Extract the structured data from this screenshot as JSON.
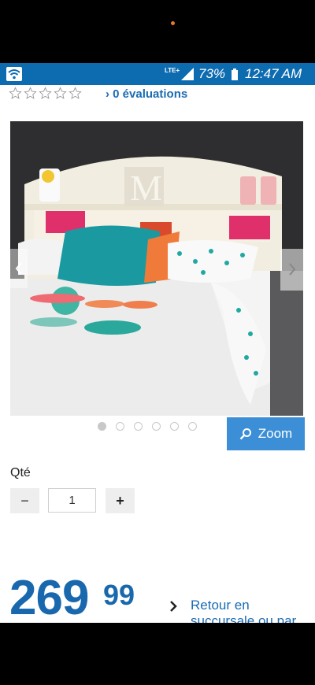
{
  "status_bar": {
    "network": "LTE+",
    "battery": "73%",
    "time": "12:47 AM",
    "colors": {
      "bar": "#0d6bb0",
      "notification_dot": "#e8792b"
    }
  },
  "product": {
    "rating_stars": 0,
    "rating_max": 5,
    "reviews_label": "0 évaluations",
    "image_count": 6,
    "active_image_index": 0,
    "zoom_label": "Zoom"
  },
  "quantity": {
    "label": "Qté",
    "minus": "−",
    "value": "1",
    "plus": "+"
  },
  "price": {
    "dollars": "269",
    "cents": "99",
    "color": "#1968ae"
  },
  "return": {
    "label": "Retour en succursale ou par"
  },
  "icons": [
    "wifi-icon",
    "signal-icon",
    "battery-icon",
    "star-outline-icon",
    "chevron-right-icon",
    "search-icon"
  ]
}
